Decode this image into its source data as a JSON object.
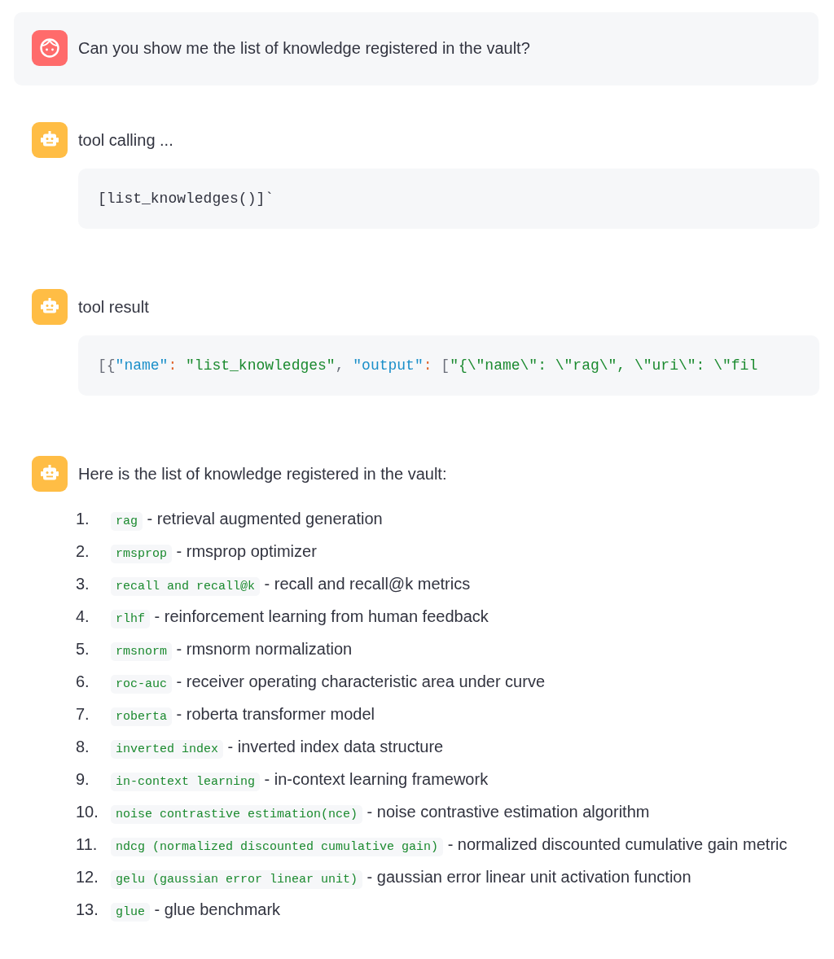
{
  "messages": [
    {
      "kind": "prompt",
      "text": "Can you show me the list of knowledge registered in the vault?"
    },
    {
      "kind": "code",
      "title": "tool calling ...",
      "code": [
        {
          "kind": "plain",
          "text": "[list_knowledges()]`"
        }
      ]
    },
    {
      "kind": "code",
      "title": "tool result",
      "code": [
        {
          "kind": "punct",
          "text": "[{"
        },
        {
          "kind": "key",
          "text": "\"name\""
        },
        {
          "kind": "colon",
          "text": ": "
        },
        {
          "kind": "string",
          "text": "\"list_knowledges\""
        },
        {
          "kind": "punct",
          "text": ", "
        },
        {
          "kind": "key",
          "text": "\"output\""
        },
        {
          "kind": "colon",
          "text": ":"
        },
        {
          "kind": "punct",
          "text": " ["
        },
        {
          "kind": "string",
          "text": "\"{\\\"name\\\": \\\"rag\\\", \\\"uri\\\": \\\"fil"
        }
      ]
    },
    {
      "kind": "list",
      "title": "Here is the list of knowledge registered in the vault:",
      "items": [
        {
          "number": "1.",
          "term": "rag",
          "text": "- retrieval augmented generation"
        },
        {
          "number": "2.",
          "term": "rmsprop",
          "text": "- rmsprop optimizer"
        },
        {
          "number": "3.",
          "term": "recall and recall@k",
          "text": "- recall and recall@k metrics"
        },
        {
          "number": "4.",
          "term": "rlhf",
          "text": "- reinforcement learning from human feedback"
        },
        {
          "number": "5.",
          "term": "rmsnorm",
          "text": "- rmsnorm normalization"
        },
        {
          "number": "6.",
          "term": "roc-auc",
          "text": "- receiver operating characteristic area under curve"
        },
        {
          "number": "7.",
          "term": "roberta",
          "text": "- roberta transformer model"
        },
        {
          "number": "8.",
          "term": "inverted index",
          "text": "- inverted index data structure"
        },
        {
          "number": "9.",
          "term": "in-context learning",
          "text": "- in-context learning framework"
        },
        {
          "number": "10.",
          "term": "noise contrastive estimation(nce)",
          "text": "- noise contrastive estimation algorithm"
        },
        {
          "number": "11.",
          "term": "ndcg (normalized discounted cumulative gain)",
          "text": "- normalized discounted cumulative gain metric"
        },
        {
          "number": "12.",
          "term": "gelu (gaussian error linear unit)",
          "text": "- gaussian error linear unit activation function"
        },
        {
          "number": "13.",
          "term": "glue",
          "text": "- glue benchmark"
        }
      ]
    }
  ]
}
